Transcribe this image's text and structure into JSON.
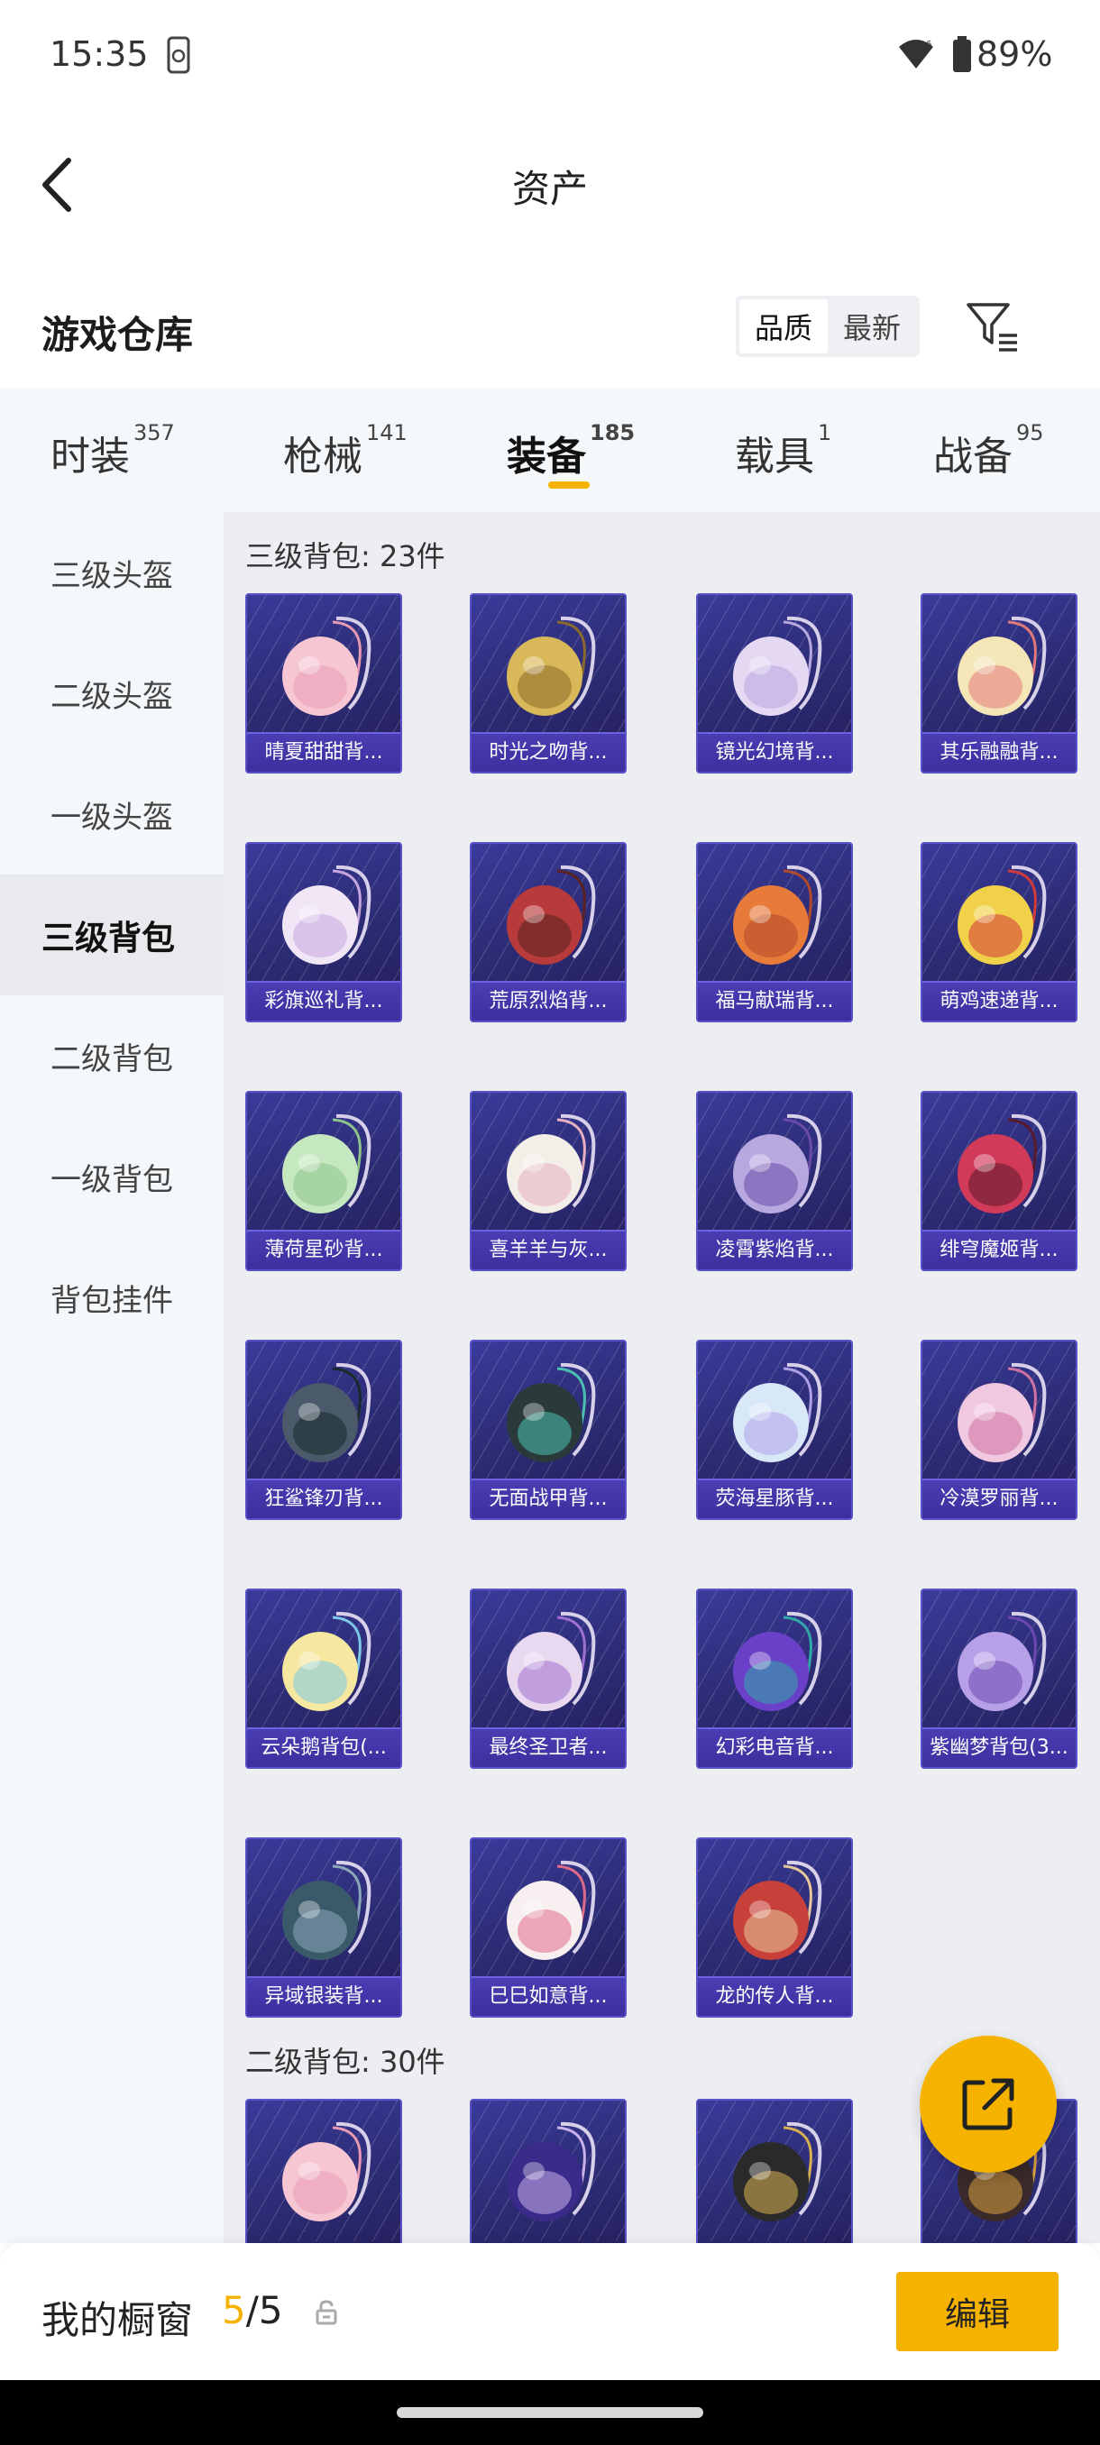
{
  "status_bar": {
    "time": "15:35",
    "battery": "89%"
  },
  "header": {
    "title": "资产"
  },
  "section": {
    "title": "游戏仓库",
    "sort_options": [
      "品质",
      "最新"
    ]
  },
  "tabs": [
    {
      "label": "时装",
      "count": "357"
    },
    {
      "label": "枪械",
      "count": "141"
    },
    {
      "label": "装备",
      "count": "185"
    },
    {
      "label": "载具",
      "count": "1"
    },
    {
      "label": "战备",
      "count": "95"
    }
  ],
  "sidebar": {
    "items": [
      "三级头盔",
      "二级头盔",
      "一级头盔",
      "三级背包",
      "二级背包",
      "一级背包",
      "背包挂件"
    ]
  },
  "groups": [
    {
      "title": "三级背包: 23件",
      "items": [
        "晴夏甜甜背...",
        "时光之吻背...",
        "镜光幻境背...",
        "其乐融融背...",
        "彩旗巡礼背...",
        "荒原烈焰背...",
        "福马献瑞背...",
        "萌鸡速递背...",
        "薄荷星砂背...",
        "喜羊羊与灰...",
        "凌霄紫焰背...",
        "绯穹魔姬背...",
        "狂鲨锋刃背...",
        "无面战甲背...",
        "荧海星豚背...",
        "冷漠罗丽背...",
        "云朵鹅背包(...",
        "最终圣卫者...",
        "幻彩电音背...",
        "紫幽梦背包(3...",
        "异域银装背...",
        "巳巳如意背...",
        "龙的传人背..."
      ]
    },
    {
      "title": "二级背包: 30件"
    }
  ],
  "bottom_bar": {
    "label": "我的橱窗",
    "current": "5",
    "total": "/5",
    "edit": "编辑"
  }
}
